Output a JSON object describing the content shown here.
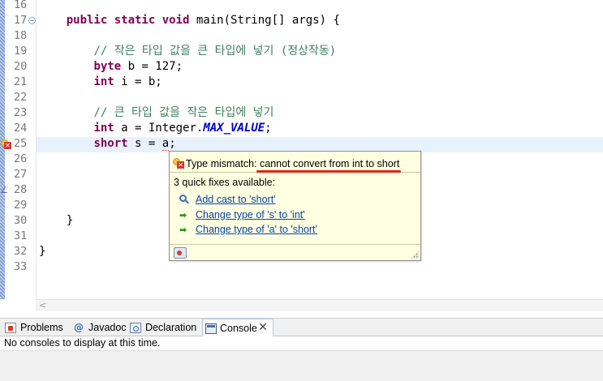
{
  "editor": {
    "lines": [
      {
        "num": "16",
        "segments": []
      },
      {
        "num": "17",
        "segments": [
          {
            "t": "    ",
            "c": ""
          },
          {
            "t": "public static void",
            "c": "kw"
          },
          {
            "t": " main(String[] args) {",
            "c": ""
          }
        ]
      },
      {
        "num": "18",
        "segments": []
      },
      {
        "num": "19",
        "segments": [
          {
            "t": "        ",
            "c": ""
          },
          {
            "t": "// 작은 타입 값을 큰 타입에 넣기 (정상작동)",
            "c": "cm"
          }
        ]
      },
      {
        "num": "20",
        "segments": [
          {
            "t": "        ",
            "c": ""
          },
          {
            "t": "byte",
            "c": "kw"
          },
          {
            "t": " b = 127;",
            "c": ""
          }
        ]
      },
      {
        "num": "21",
        "segments": [
          {
            "t": "        ",
            "c": ""
          },
          {
            "t": "int",
            "c": "kw"
          },
          {
            "t": " i = b;",
            "c": ""
          }
        ]
      },
      {
        "num": "22",
        "segments": []
      },
      {
        "num": "23",
        "segments": [
          {
            "t": "        ",
            "c": ""
          },
          {
            "t": "// 큰 타입 값을 작은 타입에 넣기",
            "c": "cm"
          }
        ]
      },
      {
        "num": "24",
        "segments": [
          {
            "t": "        ",
            "c": ""
          },
          {
            "t": "int",
            "c": "kw"
          },
          {
            "t": " a = Integer.",
            "c": ""
          },
          {
            "t": "MAX_VALUE",
            "c": "const"
          },
          {
            "t": ";",
            "c": ""
          }
        ]
      },
      {
        "num": "25",
        "segments": [
          {
            "t": "        ",
            "c": ""
          },
          {
            "t": "short",
            "c": "kw"
          },
          {
            "t": " s = ",
            "c": ""
          },
          {
            "t": "a",
            "c": "var-a"
          },
          {
            "t": ";",
            "c": ""
          }
        ]
      },
      {
        "num": "26",
        "segments": []
      },
      {
        "num": "27",
        "segments": []
      },
      {
        "num": "28",
        "segments": []
      },
      {
        "num": "29",
        "segments": []
      },
      {
        "num": "30",
        "segments": [
          {
            "t": "    }",
            "c": ""
          }
        ]
      },
      {
        "num": "31",
        "segments": []
      },
      {
        "num": "32",
        "segments": [
          {
            "t": "}",
            "c": ""
          }
        ]
      },
      {
        "num": "33",
        "segments": []
      }
    ],
    "fold_markers": [
      "16",
      "17"
    ],
    "error_line": "25",
    "warning_line": "28"
  },
  "hover": {
    "message_prefix": "Type mismatch: ",
    "message_highlight": "cannot convert from int to short",
    "fix_count": "3 quick fixes available:",
    "fixes": [
      {
        "label": "Add cast to 'short'",
        "icon": "cast-icon"
      },
      {
        "label": "Change type of 's' to 'int'",
        "icon": "change-icon"
      },
      {
        "label": "Change type of 'a' to 'short'",
        "icon": "change-icon"
      }
    ]
  },
  "views": {
    "tabs": [
      {
        "label": "Problems",
        "icon": "problems-icon"
      },
      {
        "label": "Javadoc",
        "icon": "javadoc-icon",
        "glyph": "@"
      },
      {
        "label": "Declaration",
        "icon": "declaration-icon"
      },
      {
        "label": "Console",
        "icon": "console-icon",
        "active": true
      }
    ],
    "close_glyph": "✕",
    "console_message": "No consoles to display at this time."
  },
  "colors": {
    "keyword": "#7f0055",
    "comment": "#3f7f5f",
    "constant": "#0000c0",
    "link": "#0645ad",
    "error": "#d63a2f",
    "hover_bg": "#ffffe1",
    "current_line": "#e8f2fe"
  }
}
